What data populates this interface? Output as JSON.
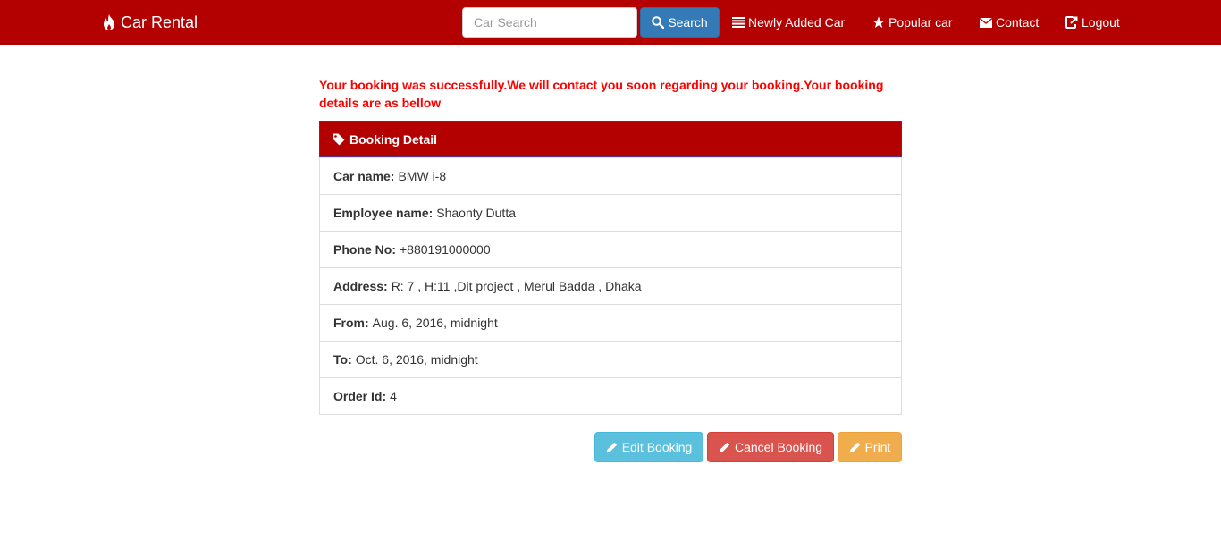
{
  "navbar": {
    "brand": "Car Rental",
    "brand_icon": "fire-icon",
    "search_placeholder": "Car Search",
    "search_value": "",
    "search_button": "Search",
    "links": [
      {
        "label": "Newly Added Car",
        "icon": "list-icon"
      },
      {
        "label": "Popular car",
        "icon": "star-icon"
      },
      {
        "label": "Contact",
        "icon": "envelope-icon"
      },
      {
        "label": "Logout",
        "icon": "logout-icon"
      }
    ],
    "color": "#b30000"
  },
  "message": "Your booking was successfully.We will contact you soon regarding your booking.Your booking details are as bellow",
  "panel": {
    "title": "Booking Detail",
    "icon": "tag-icon",
    "rows": [
      {
        "label": "Car name:",
        "value": "BMW i-8"
      },
      {
        "label": "Employee name:",
        "value": "Shaonty Dutta"
      },
      {
        "label": "Phone No:",
        "value": "+880191000000"
      },
      {
        "label": "Address:",
        "value": "R: 7 , H:11 ,Dit project , Merul Badda , Dhaka"
      },
      {
        "label": "From:",
        "value": "Aug. 6, 2016, midnight"
      },
      {
        "label": "To:",
        "value": "Oct. 6, 2016, midnight"
      },
      {
        "label": "Order Id:",
        "value": "4"
      }
    ]
  },
  "actions": {
    "edit": "Edit Booking",
    "cancel": "Cancel Booking",
    "print": "Print"
  }
}
